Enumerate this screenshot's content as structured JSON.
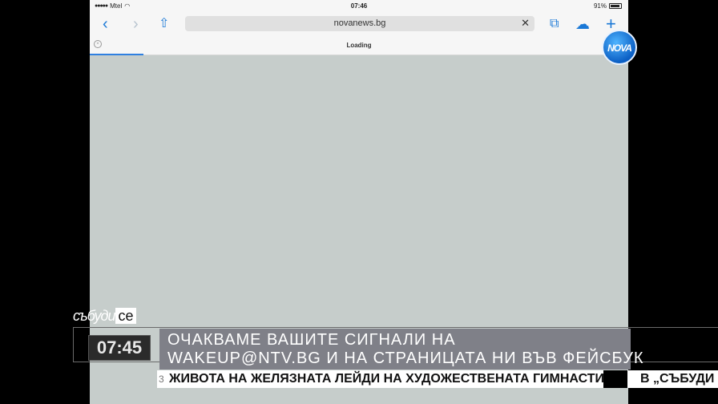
{
  "status_bar": {
    "carrier": "Mtel",
    "signal": "●●●●●",
    "time": "07:46",
    "battery": "91%"
  },
  "browser": {
    "address": "novanews.bg",
    "loading_label": "Loading",
    "progress": 0.1
  },
  "icons": {
    "back": "‹",
    "forward": "›",
    "share": "⇧",
    "clear": "✕",
    "bookmarks": "⧉",
    "cloud": "☁",
    "add": "+"
  },
  "broadcast": {
    "channel_logo": "NOVA",
    "show_brand_a": "събуди",
    "show_brand_b": "се",
    "time": "07:45",
    "headline_line1": "ОЧАКВАМЕ ВАШИТЕ СИГНАЛИ НА",
    "headline_line2": "WAKEUP@NTV.BG И НА СТРАНИЦАТА НИ ВЪВ ФЕЙСБУК",
    "ticker_bullet": "3",
    "ticker_text": "ЖИВОТА НА ЖЕЛЯЗНАТА ЛЕЙДИ НА ХУДОЖЕСТВЕНАТА ГИМНАСТИКА",
    "ticker_text2": "В „СЪБУДИ С"
  }
}
